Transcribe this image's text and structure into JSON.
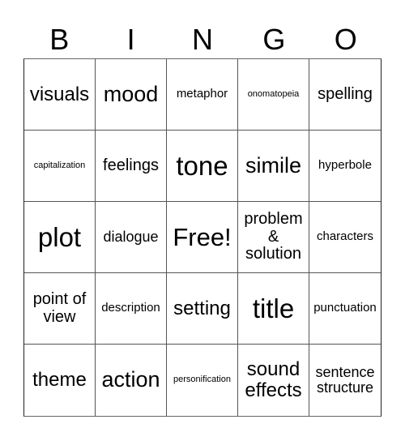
{
  "header": {
    "letters": [
      "B",
      "I",
      "N",
      "G",
      "O"
    ]
  },
  "card": {
    "rows": [
      [
        "visuals",
        "mood",
        "metaphor",
        "onomatopeia",
        "spelling"
      ],
      [
        "capitalization",
        "feelings",
        "tone",
        "simile",
        "hyperbole"
      ],
      [
        "plot",
        "dialogue",
        "Free!",
        "problem & solution",
        "characters"
      ],
      [
        "point of view",
        "description",
        "setting",
        "title",
        "punctuation"
      ],
      [
        "theme",
        "action",
        "personification",
        "sound effects",
        "sentence structure"
      ]
    ]
  }
}
